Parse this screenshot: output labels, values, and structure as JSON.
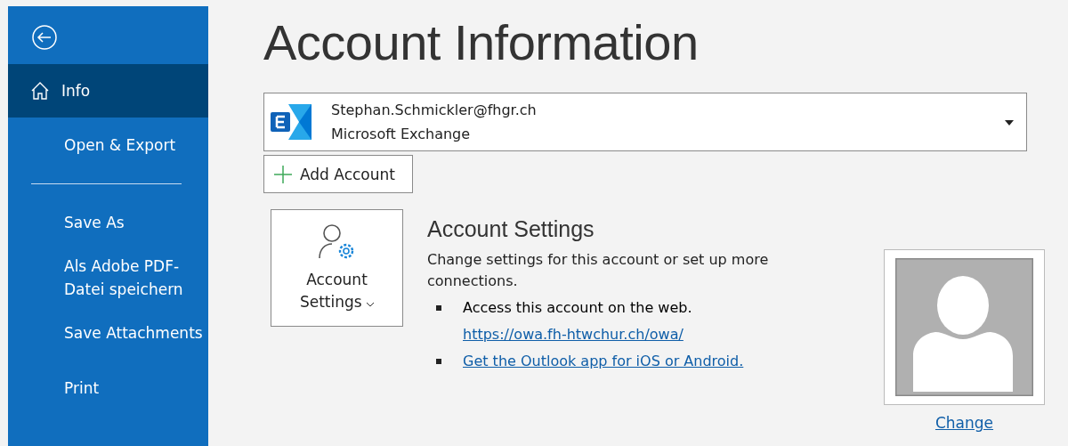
{
  "sidebar": {
    "items": [
      {
        "label": "Info",
        "selected": true
      },
      {
        "label": "Open & Export",
        "selected": false
      },
      {
        "kind": "divider"
      },
      {
        "label": "Save As",
        "selected": false
      },
      {
        "label": "Als Adobe PDF-\nDatei speichern",
        "selected": false
      },
      {
        "label": "Save Attachments",
        "selected": false
      },
      {
        "label": "Print",
        "selected": false
      }
    ]
  },
  "title": "Account Information",
  "account": {
    "email": "Stephan.Schmickler@fhgr.ch",
    "type": "Microsoft Exchange"
  },
  "add_account": "Add Account",
  "account_settings": {
    "button": "Account\nSettings",
    "heading": "Account Settings",
    "description": "Change settings for this account or set up more connections.",
    "bullets": [
      {
        "text": "Access this account on the web.",
        "link": "https://owa.fh-htwchur.ch/owa/"
      },
      {
        "link": "Get the Outlook app for iOS or Android."
      }
    ]
  },
  "photo": {
    "change": "Change"
  }
}
